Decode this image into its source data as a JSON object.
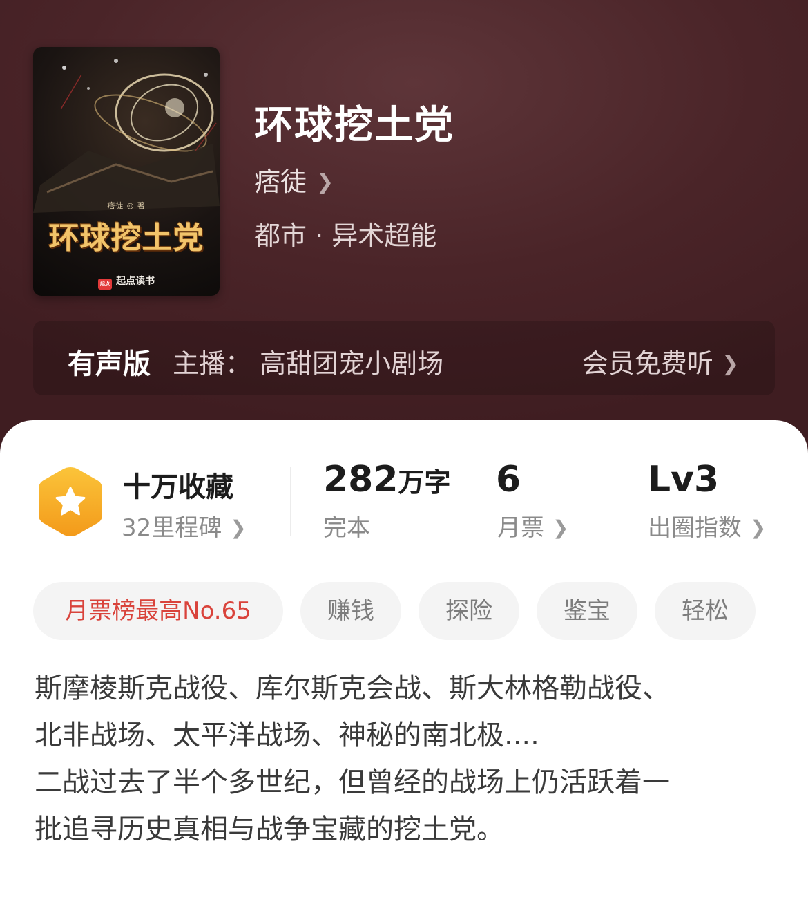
{
  "book": {
    "title": "环球挖土党",
    "author": "痞徒",
    "genre": "都市 · 异术超能",
    "cover": {
      "title": "环球挖土党",
      "author_line": "痞徒 ◎ 著",
      "brand_logo": "起点",
      "brand": "起点读书"
    }
  },
  "audio": {
    "label": "有声版",
    "host": "主播：  高甜团宠小剧场",
    "cta": "会员免费听"
  },
  "stats": {
    "collect": {
      "main": "十万收藏",
      "sub": "32里程碑"
    },
    "words": {
      "number": "282",
      "unit": "万字",
      "sub": "完本"
    },
    "tickets": {
      "number": "6",
      "sub": "月票"
    },
    "influence": {
      "number": "Lv3",
      "sub": "出圈指数"
    }
  },
  "tags": [
    "月票榜最高No.65",
    "赚钱",
    "探险",
    "鉴宝",
    "轻松"
  ],
  "synopsis": [
    "斯摩棱斯克战役、库尔斯克会战、斯大林格勒战役、",
    "北非战场、太平洋战场、神秘的南北极....",
    "二战过去了半个多世纪，但曾经的战场上仍活跃着一",
    "批追寻历史真相与战争宝藏的挖土党。"
  ],
  "colors": {
    "hero_bg": "#4a2428",
    "accent_red": "#d9433b",
    "badge_orange": "#f5a524"
  },
  "icons": [
    "chevron-right-icon",
    "star-badge-icon"
  ]
}
